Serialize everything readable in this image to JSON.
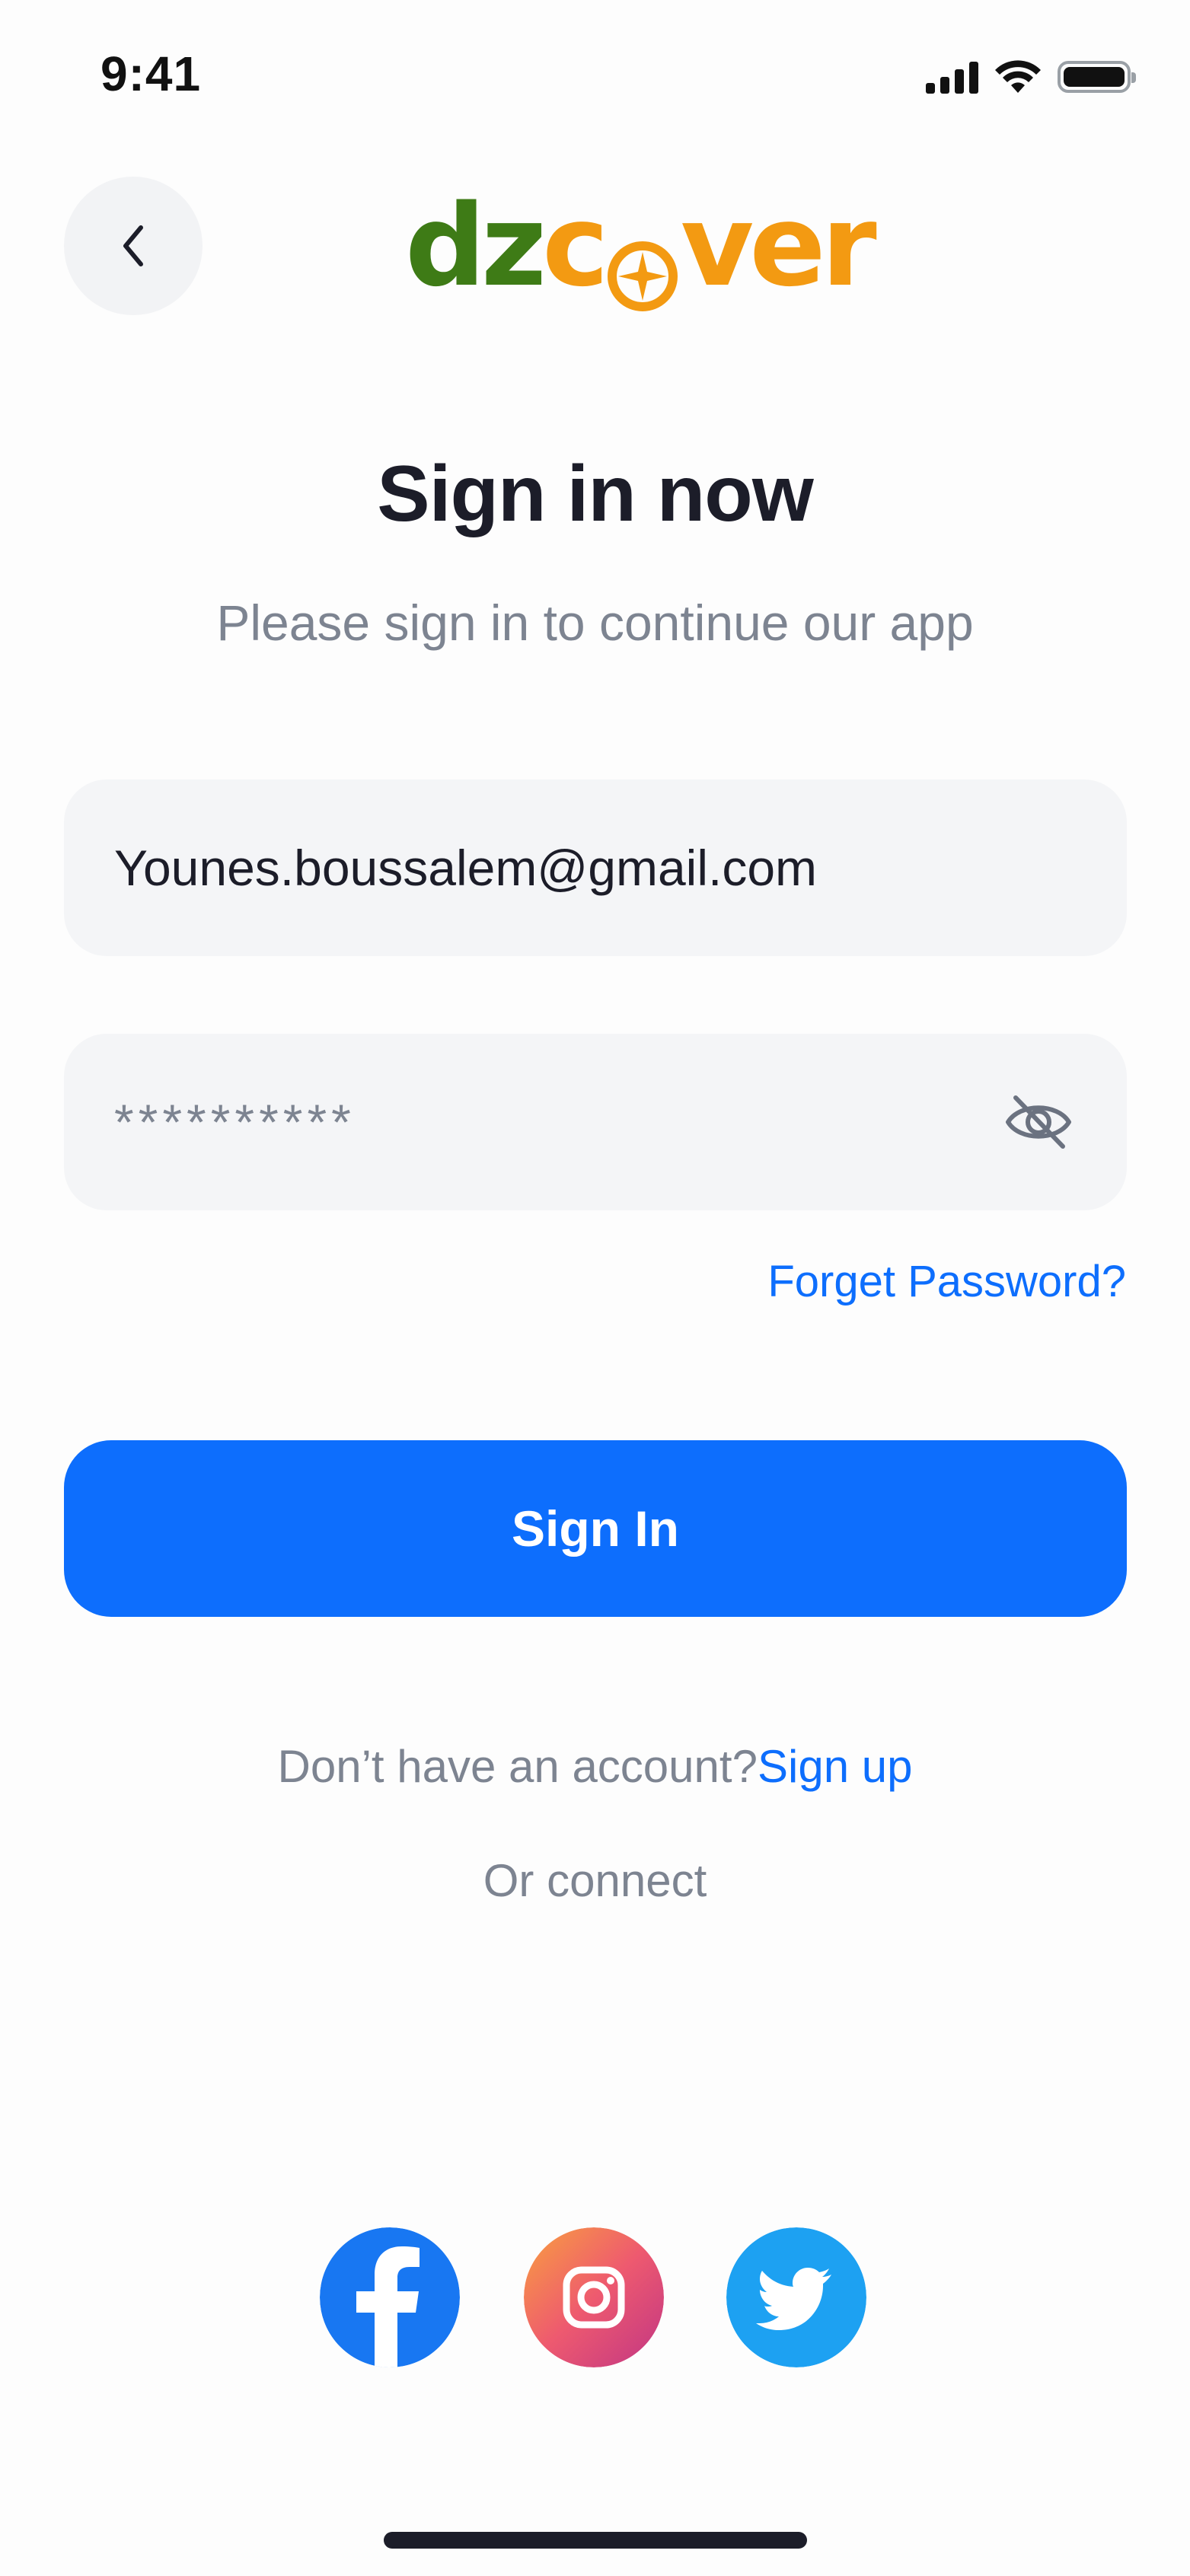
{
  "status_bar": {
    "time": "9:41",
    "signal_icon": "cellular-signal-icon",
    "wifi_icon": "wifi-icon",
    "battery_icon": "battery-icon"
  },
  "header": {
    "back_icon": "chevron-left-icon",
    "logo_alt": "dzcover"
  },
  "page": {
    "title": "Sign in now",
    "subtitle": "Please sign in to continue our app"
  },
  "form": {
    "email_value": "Younes.boussalem@gmail.com",
    "password_value": "**********",
    "password_toggle_icon": "eye-off-icon",
    "forgot_label": "Forget Password?",
    "submit_label": "Sign In"
  },
  "footer": {
    "account_prompt": "Don’t have an account?",
    "signup_label": "Sign up",
    "or_connect": "Or connect"
  },
  "social": [
    {
      "name": "facebook",
      "icon": "facebook-icon",
      "color": "#1877F2"
    },
    {
      "name": "instagram",
      "icon": "instagram-icon",
      "color": "#E1306C"
    },
    {
      "name": "twitter",
      "icon": "twitter-icon",
      "color": "#1DA1F2"
    }
  ],
  "colors": {
    "primary": "#0D6EFD",
    "logo_green": "#3E7B16",
    "logo_orange": "#F39A12",
    "muted_text": "#7D8491",
    "field_bg": "#F4F5F7"
  }
}
